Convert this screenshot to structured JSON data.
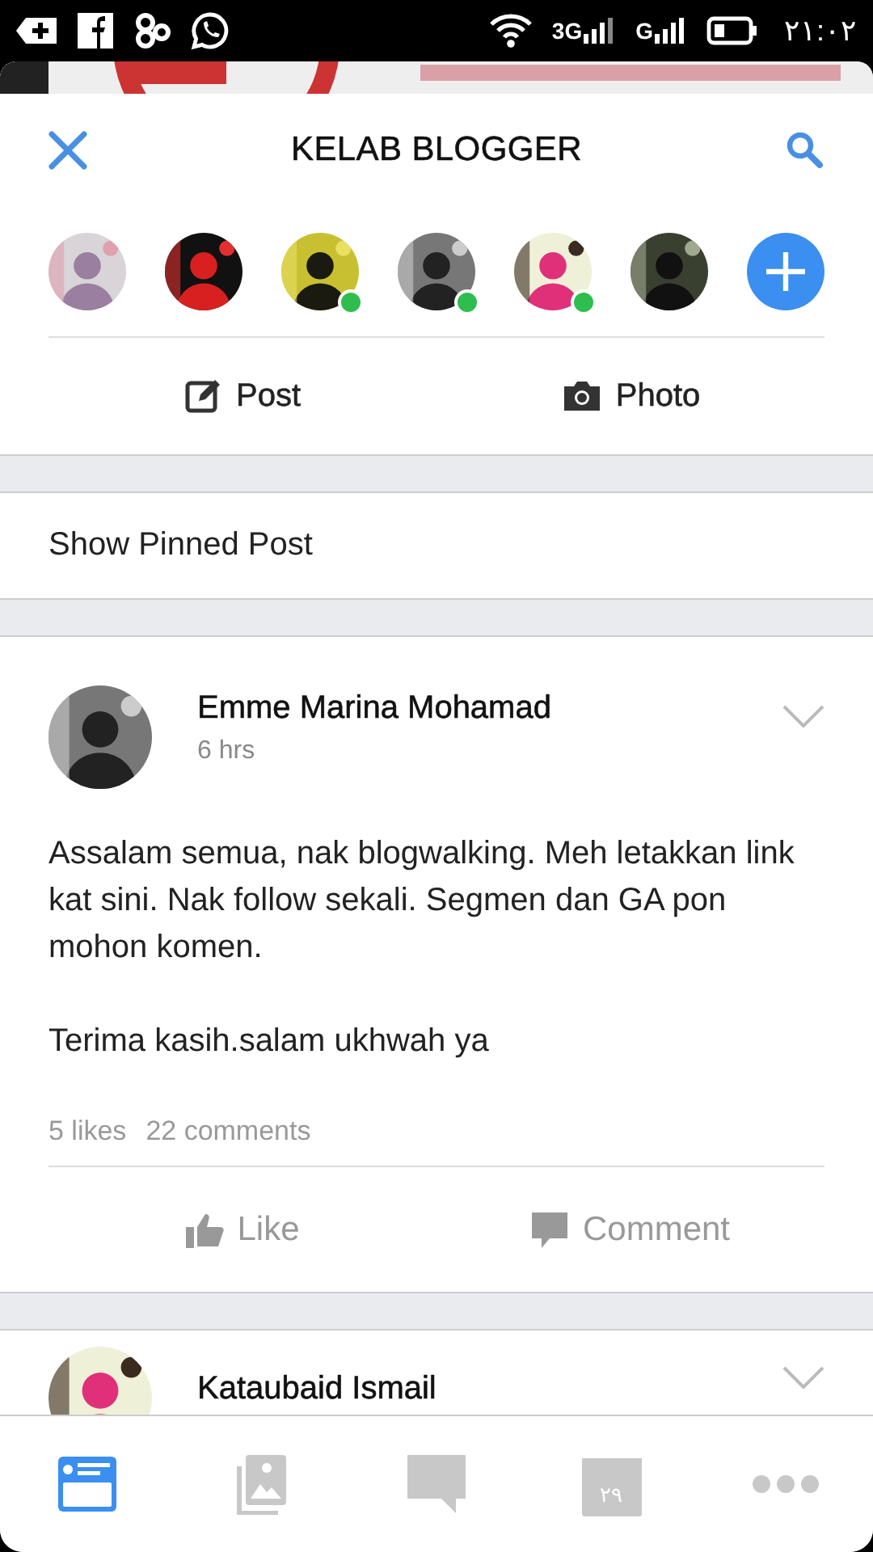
{
  "status_bar": {
    "network_1": "3G",
    "network_2": "G",
    "time": "٢١:٠٢"
  },
  "header": {
    "title": "KELAB BLOGGER"
  },
  "members": [
    {
      "online": false
    },
    {
      "online": false
    },
    {
      "online": true
    },
    {
      "online": true
    },
    {
      "online": true
    },
    {
      "online": false
    }
  ],
  "composer": [
    {
      "label": "Post",
      "kind": "post"
    },
    {
      "label": "Photo"
    }
  ],
  "pinned": {
    "label": "Show Pinned Post"
  },
  "posts": [
    {
      "author": "Emme Marina Mohamad",
      "time": "6 hrs",
      "paragraphs": [
        "Assalam semua, nak blogwalking. Meh letakkan link kat sini. Nak follow sekali. Segmen dan GA pon mohon komen.",
        "Terima kasih.salam ukhwah ya"
      ],
      "likes": "5 likes",
      "comments": "22 comments",
      "actions": [
        {
          "label": "Like",
          "kind": "like"
        },
        {
          "label": "Comment",
          "kind": "comment"
        }
      ]
    },
    {
      "author": "Kataubaid Ismail"
    }
  ],
  "bottom_nav": [
    {
      "kind": "feed",
      "selected": true
    },
    {
      "kind": "photos",
      "selected": false
    },
    {
      "kind": "chat",
      "selected": false
    },
    {
      "kind": "events",
      "selected": false,
      "day": "٢٩"
    },
    {
      "kind": "more",
      "selected": false
    }
  ]
}
